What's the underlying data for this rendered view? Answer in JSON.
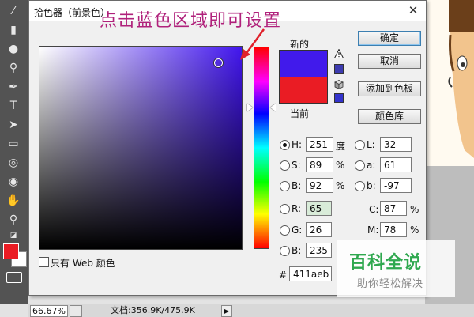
{
  "dialog": {
    "title": "拾色器（前景色）",
    "close_glyph": "✕",
    "annotation": "点击蓝色区域即可设置",
    "new_label": "新的",
    "current_label": "当前",
    "new_color": "#411aeb",
    "current_color": "#ea1c24",
    "gamut_swatch": "#3d3bb0",
    "web_swatch": "#3333cc",
    "buttons": {
      "ok": "确定",
      "cancel": "取消",
      "add_swatches": "添加到色板",
      "libraries": "颜色库"
    },
    "web_only_label": "只有 Web 颜色",
    "fields": {
      "H": {
        "label": "H:",
        "value": "251",
        "unit": "度"
      },
      "S": {
        "label": "S:",
        "value": "89",
        "unit": "%"
      },
      "B": {
        "label": "B:",
        "value": "92",
        "unit": "%"
      },
      "R": {
        "label": "R:",
        "value": "65"
      },
      "G": {
        "label": "G:",
        "value": "26"
      },
      "Bl": {
        "label": "B:",
        "value": "235"
      },
      "L": {
        "label": "L:",
        "value": "32"
      },
      "a": {
        "label": "a:",
        "value": "61"
      },
      "b": {
        "label": "b:",
        "value": "-97"
      },
      "C": {
        "label": "C:",
        "value": "87",
        "unit": "%"
      },
      "M": {
        "label": "M:",
        "value": "78",
        "unit": "%"
      },
      "hex": {
        "label": "#",
        "value": "411aeb"
      }
    }
  },
  "statusbar": {
    "zoom": "66.67%",
    "doc": "文档:356.9K/475.9K"
  },
  "toolbar": {
    "foreground": "#ea1c24",
    "background": "#ffffff"
  },
  "watermark": {
    "title": "百科全说",
    "subtitle": "助你轻松解决"
  }
}
